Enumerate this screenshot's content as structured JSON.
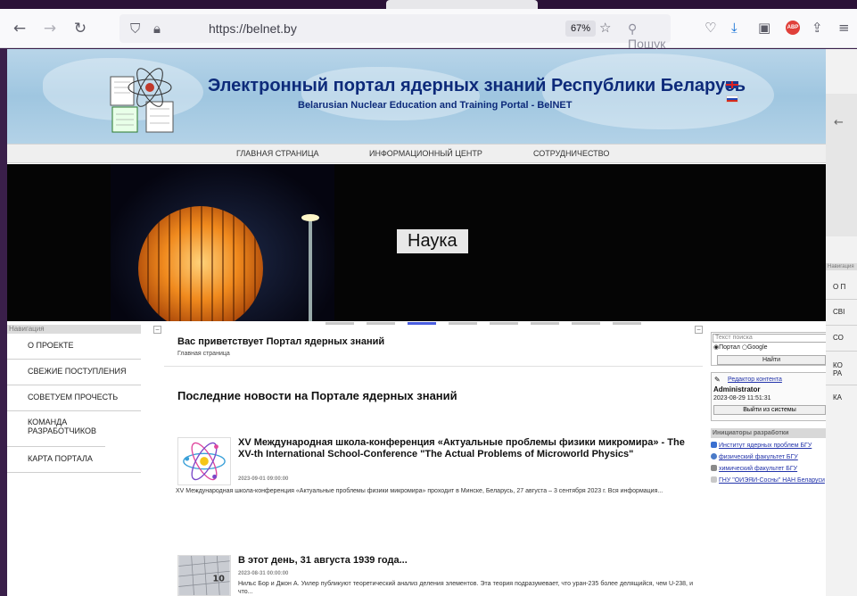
{
  "browser": {
    "url": "https://belnet.by",
    "zoom": "67%",
    "search_placeholder": "Пошук"
  },
  "header": {
    "title": "Электронный портал ядерных знаний Республики Беларусь",
    "subtitle": "Belarusian Nuclear Education and Training Portal - BelNET"
  },
  "main_menu": [
    "ГЛАВНАЯ СТРАНИЦА",
    "ИНФОРМАЦИОННЫЙ ЦЕНТР",
    "СОТРУДНИЧЕСТВО"
  ],
  "slider": {
    "caption": "Наука",
    "active_dot": 2
  },
  "left_nav": {
    "heading": "Навигация",
    "items": [
      "О ПРОЕКТЕ",
      "СВЕЖИЕ ПОСТУПЛЕНИЯ",
      "СОВЕТУЕМ ПРОЧЕСТЬ",
      "КОМАНДА РАЗРАБОТЧИКОВ",
      "КАРТА ПОРТАЛА"
    ]
  },
  "center": {
    "welcome": "Вас приветствует Портал ядерных знаний",
    "breadcrumb": "Главная страница",
    "news_heading": "Последние новости на Портале ядерных знаний",
    "news": [
      {
        "title": "XV Международная школа-конференция «Актуальные проблемы физики микромира» - The XV-th International School-Conference \"The Actual Problems of Microworld Physics\"",
        "date": "2023-09-01 09:00:00",
        "text": "XV Международная школа-конференция «Актуальные проблемы физики микромира» проходит в Минске, Беларусь, 27 августа – 3 сентября 2023 г. Вся информация..."
      },
      {
        "title": "В этот день, 31 августа 1939 года...",
        "date": "2023-08-31 00:00:00",
        "text": "Нильс Бор и Джон А. Уилер публикуют теоретический анализ деления элементов. Эта теория подразумевает, что уран-235 более делящийся, чем U-238, и что..."
      }
    ]
  },
  "right": {
    "search_placeholder": "Текст поиска",
    "radio_portal": "Портал",
    "radio_google": "Google",
    "search_button": "Найти",
    "editor_link": "Редактор контента",
    "user_name": "Administrator",
    "login_time": "2023-08-29 11:51:31",
    "logout_button": "Выйти из системы",
    "initiators_heading": "Инициаторы разработки",
    "initiators": [
      "Институт ядерных проблем БГУ",
      "физический факультет БГУ",
      "химический факультет БГУ",
      "ГНУ \"ОИЭЯИ-Сосны\" НАН Беларуси"
    ]
  },
  "side_window": {
    "heading": "Навигация",
    "items": [
      "О П",
      "СВІ",
      "СО",
      "КО",
      "РА",
      "КА"
    ]
  },
  "colors": {
    "title_blue": "#0d2a7a",
    "link_blue": "#2233aa",
    "active_dot": "#4a5ee0"
  }
}
